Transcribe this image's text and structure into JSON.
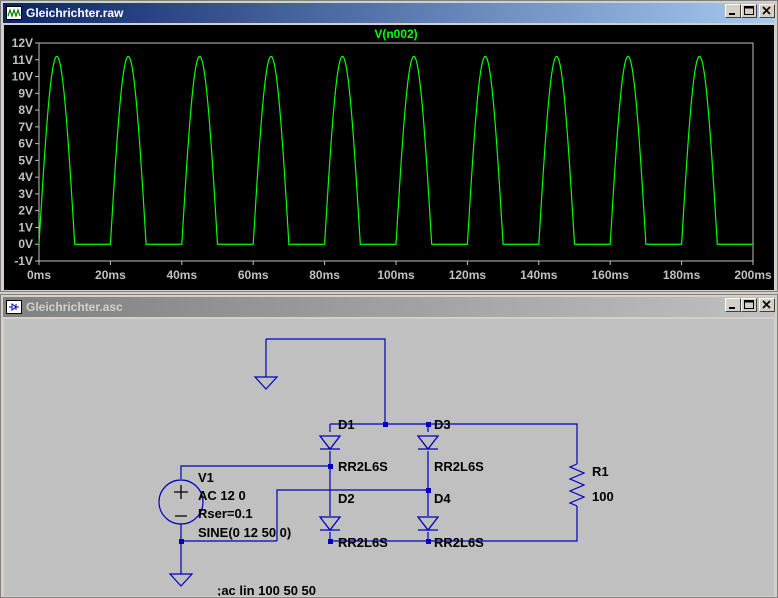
{
  "windows": {
    "waveform": {
      "title": "Gleichrichter.raw",
      "trace_label": "V(n002)",
      "trace_color": "#00ff00",
      "background_color": "#000000"
    },
    "schematic": {
      "title": "Gleichrichter.asc",
      "wire_color": "#0000c0",
      "background_color": "#c0c0c0",
      "components": {
        "V1": {
          "name": "V1",
          "line1": "AC 12 0",
          "line2": "Rser=0.1",
          "line3": "SINE(0 12 50 0)"
        },
        "D1": {
          "name": "D1",
          "model": "RR2L6S"
        },
        "D2": {
          "name": "D2",
          "model": "RR2L6S"
        },
        "D3": {
          "name": "D3",
          "model": "RR2L6S"
        },
        "D4": {
          "name": "D4",
          "model": "RR2L6S"
        },
        "R1": {
          "name": "R1",
          "value": "100"
        }
      },
      "directive": ";ac lin 100 50 50"
    }
  },
  "chart_data": {
    "type": "line",
    "title": "V(n002)",
    "xlabel": "",
    "ylabel": "",
    "xlim": [
      0,
      200
    ],
    "ylim": [
      -1,
      12
    ],
    "x_ticks": [
      "0ms",
      "20ms",
      "40ms",
      "60ms",
      "80ms",
      "100ms",
      "120ms",
      "140ms",
      "160ms",
      "180ms",
      "200ms"
    ],
    "y_ticks": [
      "-1V",
      "0V",
      "1V",
      "2V",
      "3V",
      "4V",
      "5V",
      "6V",
      "7V",
      "8V",
      "9V",
      "10V",
      "11V",
      "12V"
    ],
    "grid": false,
    "series": [
      {
        "name": "V(n002)",
        "waveform": "half-wave rectified sine",
        "frequency_hz": 50,
        "peak_v": 11.2,
        "min_v": 0,
        "peak_times_ms": [
          5,
          25,
          45,
          65,
          85,
          105,
          125,
          145,
          165,
          185
        ]
      }
    ]
  }
}
